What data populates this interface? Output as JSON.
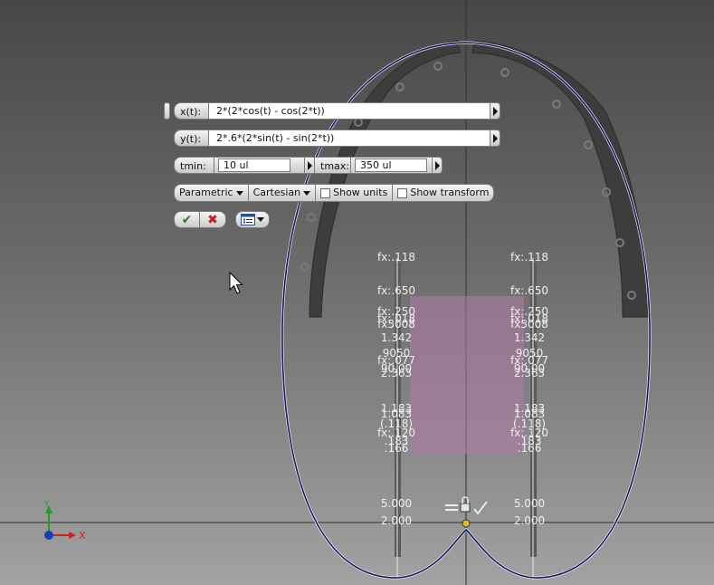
{
  "parametric_dialog": {
    "x_label": "x(t):",
    "x_value": "2*(2*cos(t) - cos(2*t))",
    "y_label": "y(t):",
    "y_value": "2*.6*(2*sin(t) - sin(2*t))",
    "tmin_label": "tmin:",
    "tmin_value": "10 ul",
    "tmax_label": "tmax:",
    "tmax_value": "350 ul",
    "coord_type": "Parametric",
    "coord_system": "Cartesian",
    "show_units_label": "Show units",
    "show_units_checked": false,
    "show_transform_label": "Show transform",
    "show_transform_checked": false,
    "ok_icon": "checkmark-icon",
    "cancel_icon": "cross-icon",
    "options_icon": "options-menu-icon"
  },
  "dimensions": {
    "left": [
      "fx:.118",
      "fx:.650",
      "fx:.250",
      "fx:.018",
      "fx5008",
      "1.342",
      "9050",
      "fx:.077",
      "90.00",
      "2.363",
      "1.183",
      "1.083",
      "(.118)",
      "fx:.120",
      ".183",
      ".166",
      "5.000",
      "2.000"
    ],
    "right": [
      "fx:.118",
      "fx:.650",
      "fx:.250",
      "fx:.018",
      "fx5008",
      "1.342",
      "9050",
      "fx:.077",
      "90.00",
      "2.363",
      "1.183",
      "1.083",
      "(.118)",
      "fx:.120",
      ".183",
      ".166",
      "5.000",
      "2.000"
    ]
  },
  "axis_triad": {
    "x_label": "X",
    "y_label": "Y",
    "x_color": "#d22020",
    "y_color": "#20a020",
    "origin_color": "#1a3fb0"
  },
  "colors": {
    "curve": "#1a1360",
    "region": "#b07aa8",
    "panels": "#3f3f3f"
  }
}
